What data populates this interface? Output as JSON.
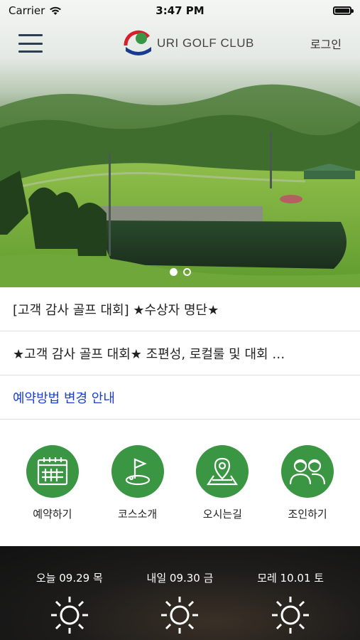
{
  "status": {
    "carrier": "Carrier",
    "time": "3:47 PM"
  },
  "header": {
    "logo_text": "URI GOLF CLUB",
    "logo_badge": "URI",
    "logo_sub": "GOLF CLUB",
    "login": "로그인"
  },
  "carousel": {
    "slide_count": 2,
    "active_index": 0
  },
  "notices": [
    {
      "text": "[고객 감사 골프 대회] ★수상자 명단★"
    },
    {
      "text": "★고객 감사 골프 대회★ 조편성, 로컬룰 및 대회 …"
    },
    {
      "text": "예약방법 변경 안내"
    }
  ],
  "quick_menu": [
    {
      "label": "예약하기",
      "icon": "calendar-icon"
    },
    {
      "label": "코스소개",
      "icon": "flag-hole-icon"
    },
    {
      "label": "오시는길",
      "icon": "map-pin-icon"
    },
    {
      "label": "조인하기",
      "icon": "people-icon"
    }
  ],
  "weather": [
    {
      "date": "오늘 09.29 목",
      "icon": "sun-icon"
    },
    {
      "date": "내일 09.30 금",
      "icon": "sun-icon"
    },
    {
      "date": "모레 10.01 토",
      "icon": "sun-icon"
    }
  ],
  "colors": {
    "accent_green": "#3a9642",
    "link_blue": "#1a3fd0"
  }
}
